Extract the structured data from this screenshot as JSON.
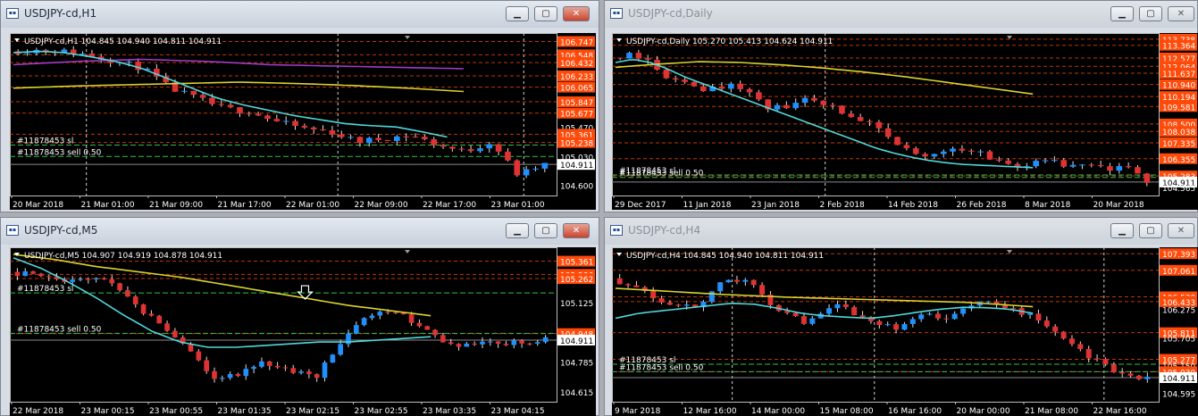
{
  "windows": [
    {
      "id": "h1",
      "title": "USDJPY-cd,H1",
      "active": true,
      "info": "USDJPY-cd,H1  104.845 104.940 104.811 104.911",
      "price_min": 104.5,
      "price_max": 106.82,
      "price_labels": [
        {
          "value": 106.747,
          "text": "106.747",
          "color": "#ff4a0a"
        },
        {
          "value": 106.548,
          "text": "106.548",
          "color": "#ff4a0a"
        },
        {
          "value": 106.432,
          "text": "106.432",
          "color": "#ff4a0a"
        },
        {
          "value": 106.233,
          "text": "106.233",
          "color": "#ff4a0a"
        },
        {
          "value": 106.065,
          "text": "106.065",
          "color": "#ff4a0a"
        },
        {
          "value": 105.847,
          "text": "105.847",
          "color": "#ff4a0a"
        },
        {
          "value": 105.677,
          "text": "105.677",
          "color": "#ff4a0a"
        },
        {
          "value": 105.47,
          "text": "105.470",
          "color": null
        },
        {
          "value": 105.361,
          "text": "105.361",
          "color": "#ff4a0a"
        },
        {
          "value": 105.238,
          "text": "105.238",
          "color": "#ff4a0a"
        },
        {
          "value": 105.03,
          "text": "105.030",
          "color": null
        },
        {
          "value": 104.911,
          "text": "104.911",
          "color": "#ffffff"
        },
        {
          "value": 104.6,
          "text": "104.600",
          "color": null
        }
      ],
      "time_labels": [
        "20 Mar 2018",
        "21 Mar 01:00",
        "21 Mar 09:00",
        "21 Mar 17:00",
        "22 Mar 01:00",
        "22 Mar 09:00",
        "22 Mar 17:00",
        "23 Mar 01:00"
      ],
      "order_labels": [
        "#11878453 sl",
        "#11878453 sell 0.50"
      ],
      "order_values": [
        105.2,
        105.03
      ],
      "vlines": [
        0.14,
        0.6,
        0.94
      ],
      "close_path": [
        106.6,
        106.62,
        106.6,
        106.55,
        106.45,
        106.35,
        106.05,
        105.9,
        105.75,
        105.7,
        105.55,
        105.45,
        105.4,
        105.25,
        105.3,
        105.35,
        105.2,
        105.1,
        105.25,
        104.75,
        104.911
      ],
      "ma_fast": [
        106.58,
        106.6,
        106.58,
        106.52,
        106.45,
        106.35,
        106.2,
        106.05,
        105.9,
        105.8,
        105.72,
        105.64,
        105.58,
        105.52,
        105.49,
        105.47,
        105.4,
        105.32
      ],
      "ma_mid": [
        106.4,
        106.45,
        106.48,
        106.45,
        106.4,
        106.38,
        106.36,
        106.34
      ],
      "ma_slow": [
        106.05,
        106.08,
        106.1,
        106.12,
        106.14,
        106.12,
        106.09,
        106.05,
        106.0
      ],
      "candles": 58,
      "seed": 11
    },
    {
      "id": "daily",
      "title": "USDJPY-cd,Daily",
      "active": false,
      "info": "USDJPY-cd,Daily  105.270 105.413 104.624 104.911",
      "price_min": 104.3,
      "price_max": 113.9,
      "price_labels": [
        {
          "value": 113.738,
          "text": "113.738",
          "color": "#ff4a0a"
        },
        {
          "value": 113.364,
          "text": "113.364",
          "color": "#ff4a0a"
        },
        {
          "value": 112.577,
          "text": "112.577",
          "color": "#ff4a0a"
        },
        {
          "value": 112.064,
          "text": "112.064",
          "color": "#ff4a0a"
        },
        {
          "value": 111.637,
          "text": "111.637",
          "color": "#ff4a0a"
        },
        {
          "value": 110.94,
          "text": "110.940",
          "color": "#ff4a0a"
        },
        {
          "value": 110.194,
          "text": "110.194",
          "color": "#ff4a0a"
        },
        {
          "value": 109.581,
          "text": "109.581",
          "color": "#ff4a0a"
        },
        {
          "value": 108.5,
          "text": "108.500",
          "color": "#ff4a0a"
        },
        {
          "value": 108.038,
          "text": "108.038",
          "color": "#ff4a0a"
        },
        {
          "value": 107.335,
          "text": "107.335",
          "color": "#ff4a0a"
        },
        {
          "value": 106.355,
          "text": "106.355",
          "color": "#ff4a0a"
        },
        {
          "value": 105.283,
          "text": "105.283",
          "color": "#ff4a0a"
        },
        {
          "value": 104.911,
          "text": "104.911",
          "color": "#ffffff"
        },
        {
          "value": 104.565,
          "text": "104.565",
          "color": null
        }
      ],
      "time_labels": [
        "29 Dec 2017",
        "11 Jan 2018",
        "23 Jan 2018",
        "2 Feb 2018",
        "14 Feb 2018",
        "26 Feb 2018",
        "8 Mar 2018",
        "20 Mar 2018"
      ],
      "order_labels": [
        "#11878453 sl",
        "#11878453 sell 0.50"
      ],
      "order_values": [
        105.35,
        105.2
      ],
      "vlines": [
        0.39
      ],
      "close_path": [
        112.6,
        112.9,
        112.4,
        111.2,
        110.9,
        110.6,
        111.0,
        110.4,
        109.4,
        109.6,
        110.1,
        109.7,
        108.9,
        108.5,
        107.6,
        106.8,
        106.4,
        107.1,
        106.9,
        106.5,
        106.0,
        105.9,
        106.3,
        105.7,
        106.0,
        105.6,
        105.8,
        104.911
      ],
      "ma_fast": [
        112.3,
        112.5,
        112.3,
        111.9,
        111.4,
        111.0,
        110.6,
        110.2,
        109.8,
        109.4,
        109.0,
        108.6,
        108.2,
        107.8,
        107.4,
        107.0,
        106.7,
        106.45,
        106.25,
        106.1,
        106.0,
        105.95,
        105.9,
        105.85,
        105.8
      ],
      "ma_mid": [
        112.0,
        112.2,
        112.35,
        112.3,
        112.15,
        111.95,
        111.7,
        111.4,
        111.05,
        110.7,
        110.35
      ],
      "ma_slow": [],
      "candles": 58,
      "seed": 23
    },
    {
      "id": "m5",
      "title": "USDJPY-cd,M5",
      "active": true,
      "info": "USDJPY-cd,M5  104.907 104.919 104.878 104.911",
      "price_min": 104.58,
      "price_max": 105.42,
      "price_labels": [
        {
          "value": 105.361,
          "text": "105.361",
          "color": "#ff4a0a"
        },
        {
          "value": 105.286,
          "text": "105.286",
          "color": "#ff4a0a"
        },
        {
          "value": 105.262,
          "text": "105.262",
          "color": "#ff4a0a"
        },
        {
          "value": 105.125,
          "text": "105.125",
          "color": null
        },
        {
          "value": 104.948,
          "text": "104.948",
          "color": "#ff4a0a"
        },
        {
          "value": 104.911,
          "text": "104.911",
          "color": "#ffffff"
        },
        {
          "value": 104.785,
          "text": "104.785",
          "color": null
        },
        {
          "value": 104.615,
          "text": "104.615",
          "color": null
        }
      ],
      "time_labels": [
        "22 Mar 2018",
        "23 Mar 00:15",
        "23 Mar 00:55",
        "23 Mar 01:35",
        "23 Mar 02:15",
        "23 Mar 02:55",
        "23 Mar 03:35",
        "23 Mar 04:15"
      ],
      "order_labels": [
        "#11878453 sl",
        "#11878453 sell 0.50"
      ],
      "order_values": [
        105.18,
        104.95
      ],
      "vlines": [],
      "close_path": [
        105.3,
        105.28,
        105.25,
        105.27,
        105.24,
        105.1,
        105.0,
        104.85,
        104.7,
        104.72,
        104.78,
        104.74,
        104.7,
        104.9,
        105.05,
        105.08,
        105.0,
        104.9,
        104.88,
        104.89,
        104.9,
        104.911
      ],
      "ma_fast": [
        105.38,
        105.32,
        105.24,
        105.15,
        105.05,
        104.96,
        104.9,
        104.87,
        104.87,
        104.88,
        104.89,
        104.9,
        104.9,
        104.91,
        104.92,
        104.93
      ],
      "ma_mid": [
        105.4,
        105.37,
        105.33,
        105.3,
        105.27,
        105.23,
        105.19,
        105.15,
        105.11,
        105.08,
        105.05
      ],
      "ma_slow": [],
      "candles": 68,
      "seed": 37
    },
    {
      "id": "h4",
      "title": "USDJPY-cd,H4",
      "active": false,
      "info": "USDJPY-cd,H4  104.845 104.940 104.811 104.911",
      "price_min": 104.5,
      "price_max": 107.45,
      "price_labels": [
        {
          "value": 107.393,
          "text": "107.393",
          "color": "#ff4a0a"
        },
        {
          "value": 107.061,
          "text": "107.061",
          "color": "#ff4a0a"
        },
        {
          "value": 106.53,
          "text": "106.530",
          "color": "#ff4a0a"
        },
        {
          "value": 106.433,
          "text": "106.433",
          "color": "#ff4a0a"
        },
        {
          "value": 106.275,
          "text": "106.275",
          "color": null
        },
        {
          "value": 105.811,
          "text": "105.811",
          "color": "#ff4a0a"
        },
        {
          "value": 105.705,
          "text": "105.705",
          "color": null
        },
        {
          "value": 105.277,
          "text": "105.277",
          "color": "#ff4a0a"
        },
        {
          "value": 105.15,
          "text": "105.150",
          "color": null
        },
        {
          "value": 105.03,
          "text": "105.030",
          "color": "#ff4a0a"
        },
        {
          "value": 104.911,
          "text": "104.911",
          "color": "#ffffff"
        },
        {
          "value": 104.595,
          "text": "104.595",
          "color": null
        }
      ],
      "time_labels": [
        "9 Mar 2018",
        "12 Mar 16:00",
        "14 Mar 00:00",
        "15 Mar 08:00",
        "16 Mar 16:00",
        "20 Mar 00:00",
        "21 Mar 08:00",
        "22 Mar 16:00"
      ],
      "order_labels": [
        "#11878453 sl",
        "#11878453 sell 0.50"
      ],
      "order_values": [
        105.18,
        105.03
      ],
      "vlines": [
        0.22,
        0.48,
        0.9
      ],
      "close_path": [
        106.9,
        106.7,
        106.4,
        106.3,
        106.9,
        106.8,
        106.2,
        106.0,
        106.4,
        106.1,
        105.9,
        106.2,
        106.1,
        106.4,
        106.35,
        106.1,
        105.7,
        105.3,
        105.0,
        104.911
      ],
      "ma_fast": [
        106.1,
        106.2,
        106.25,
        106.3,
        106.35,
        106.4,
        106.38,
        106.3,
        106.2,
        106.15,
        106.12,
        106.1,
        106.15,
        106.22,
        106.28,
        106.32,
        106.31,
        106.28,
        106.2
      ],
      "ma_mid": [
        106.7,
        106.66,
        106.62,
        106.58,
        106.55,
        106.52,
        106.5,
        106.48,
        106.46,
        106.44,
        106.42,
        106.38,
        106.33
      ],
      "ma_slow": [],
      "candles": 64,
      "seed": 53
    }
  ],
  "colors": {
    "bull": "#1e90ff",
    "bear": "#e03232",
    "ma_fast": "#4fd8dc",
    "ma_mid": "#d9d32e",
    "ma_slow": "#d9d32e",
    "ma_purple": "#a23ac6",
    "order": "#2fbf4a",
    "level": "#ff4a0a",
    "grid": "#4a4a4a",
    "axis_text": "#ffffff"
  },
  "icons": {
    "window": "chart-window-icon",
    "minimize": "minimize-icon",
    "restore": "restore-icon",
    "close": "close-icon"
  }
}
